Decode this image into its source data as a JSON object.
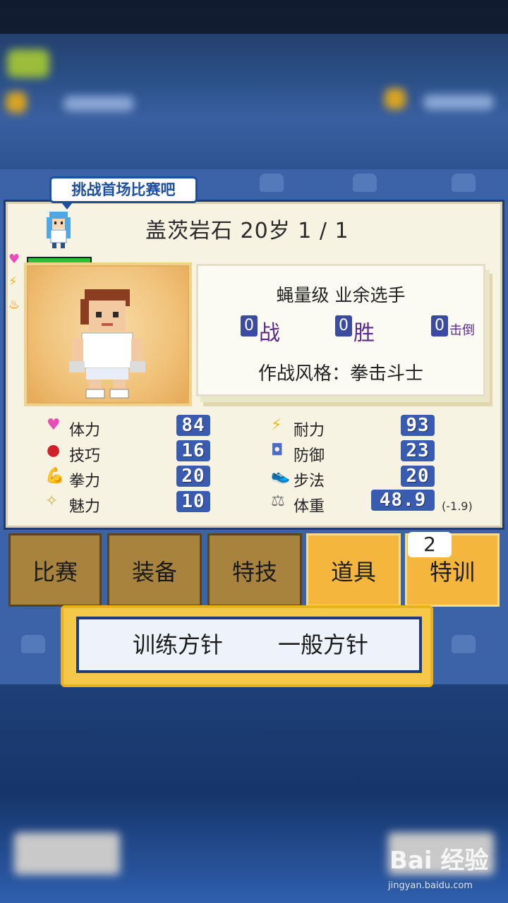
{
  "coach_speech": "挑战首场比赛吧",
  "title": "盖茨岩石 20岁 1 / 1",
  "bars": {
    "stamina_fill": 1.0,
    "energy_fill": 1.0,
    "fire_fill": 0.0
  },
  "info": {
    "class_line": "蝇量级 业余选手",
    "fights_num": "0",
    "fights_label": "战",
    "wins_num": "0",
    "wins_label": "胜",
    "ko_num": "0",
    "ko_label": "击倒",
    "style_line": "作战风格：拳击斗士"
  },
  "stats": {
    "stamina_label": "体力",
    "stamina_value": "84",
    "technique_label": "技巧",
    "technique_value": "16",
    "power_label": "拳力",
    "power_value": "20",
    "charm_label": "魅力",
    "charm_value": "10",
    "endurance_label": "耐力",
    "endurance_value": "93",
    "defense_label": "防御",
    "defense_value": "23",
    "footwork_label": "步法",
    "footwork_value": "20",
    "weight_label": "体重",
    "weight_value": "48.9",
    "weight_delta": "(-1.9)"
  },
  "tabs": {
    "match": "比赛",
    "equipment": "装备",
    "special": "特技",
    "items": "道具",
    "training": "特训",
    "training_badge": "2"
  },
  "policy": {
    "label": "训练方针",
    "value": "一般方针"
  },
  "watermark": {
    "brand": "Bai 经验",
    "url": "jingyan.baidu.com"
  },
  "colors": {
    "stat_box": "#3a5cb0",
    "tab_active": "#f5b63d",
    "tab_dim": "#a8833e",
    "policy_border": "#f5c84a"
  }
}
